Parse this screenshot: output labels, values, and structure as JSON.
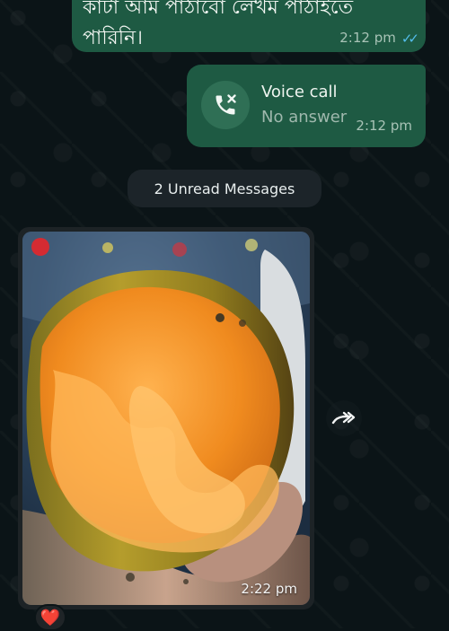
{
  "chat": {
    "messages": [
      {
        "type": "text",
        "text_lines": [
          "কাটা আম পাঠাবো লেখম পাঠাইতে",
          "পারিনি।"
        ],
        "time": "2:12 pm",
        "status": "read"
      },
      {
        "type": "voice_call",
        "title": "Voice call",
        "status_text": "No answer",
        "time": "2:12 pm",
        "icon": "phone-missed-call-icon"
      },
      {
        "type": "separator",
        "text": "2 Unread Messages"
      },
      {
        "type": "image",
        "content": "mango-photo",
        "time": "2:22 pm",
        "reaction": "❤️"
      }
    ]
  },
  "colors": {
    "background": "#0b1417",
    "outgoing_bubble": "#1e5a43",
    "incoming_bubble": "#1d2326",
    "read_ticks": "#53bdeb",
    "secondary_text": "#a8c3b6"
  },
  "icons": {
    "forward": "forward-arrow-icon",
    "read_status": "double-check-icon"
  }
}
